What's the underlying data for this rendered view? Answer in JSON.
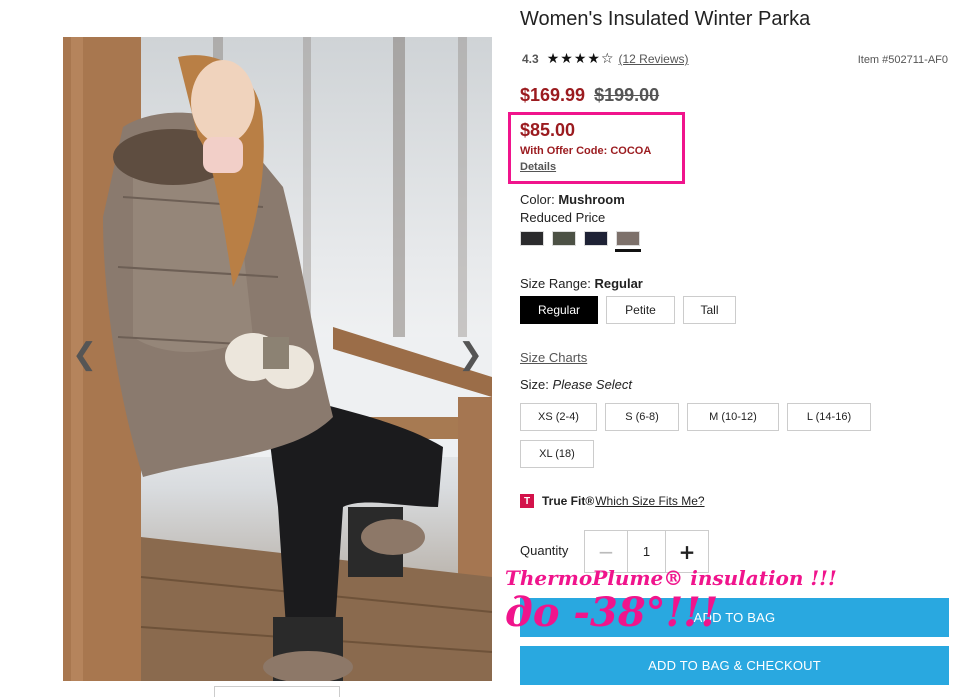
{
  "product": {
    "title": "Women's Insulated Winter Parka",
    "rating": "4.3",
    "stars": [
      "★",
      "★",
      "★",
      "★",
      "☆"
    ],
    "reviews_link": "(12 Reviews)",
    "item_number": "Item #502711-AF0"
  },
  "pricing": {
    "sale_price": "$169.99",
    "original_price": "$199.00",
    "offer_price": "$85.00",
    "offer_code_text": "With Offer Code: COCOA",
    "details_link": "Details"
  },
  "color": {
    "label": "Color:",
    "selected": "Mushroom",
    "note": "Reduced Price",
    "swatches": [
      {
        "name": "black",
        "hex": "#2b2b2d"
      },
      {
        "name": "olive",
        "hex": "#4c5145"
      },
      {
        "name": "navy",
        "hex": "#1e2235"
      },
      {
        "name": "mushroom",
        "hex": "#7d716b"
      }
    ]
  },
  "size_range": {
    "label": "Size Range:",
    "selected": "Regular",
    "options": [
      "Regular",
      "Petite",
      "Tall"
    ]
  },
  "size": {
    "charts_link": "Size Charts",
    "label": "Size:",
    "prompt": "Please Select",
    "options": [
      "XS (2-4)",
      "S (6-8)",
      "M (10-12)",
      "L (14-16)",
      "XL (18)"
    ]
  },
  "truefit": {
    "logo": "T",
    "brand": "True Fit®",
    "link": "Which Size Fits Me?"
  },
  "quantity": {
    "label": "Quantity",
    "value": "1",
    "minus": "−",
    "plus": "+"
  },
  "actions": {
    "add_to_bag": "ADD TO BAG",
    "add_to_bag_checkout": "ADD TO BAG & CHECKOUT"
  },
  "overlay": {
    "line1": "ThermoPlume® insulation !!!",
    "line2": "до -38°!!!"
  },
  "gallery": {
    "prev": "❮",
    "next": "❯"
  },
  "colors": {
    "sale_red": "#9b1b1f",
    "highlight_pink": "#f0148c",
    "button_blue": "#29a8e0"
  }
}
